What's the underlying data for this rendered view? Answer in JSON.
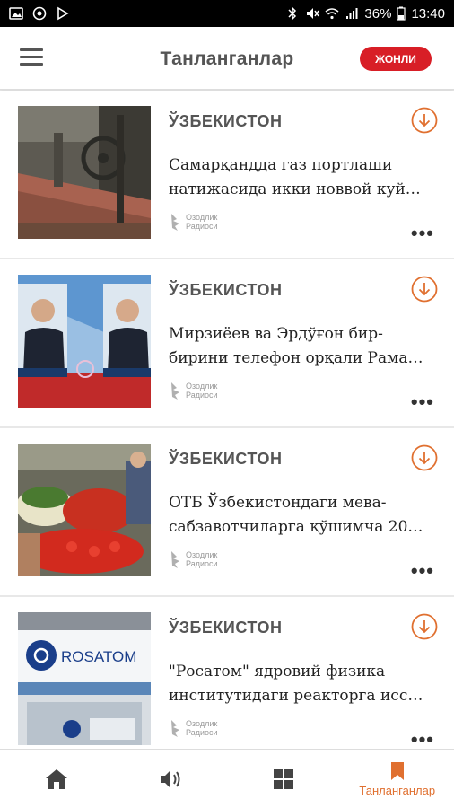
{
  "status_bar": {
    "battery": "36%",
    "time": "13:40"
  },
  "app_bar": {
    "title": "Танланганлар",
    "live_label": "ЖОНЛИ"
  },
  "articles": [
    {
      "category": "ЎЗБЕКИСТОН",
      "headline_line1": "Самарқандда газ портлаши",
      "headline_line2": "натижасида икки новвой куй…",
      "source_line1": "Озодлик",
      "source_line2": "Радиоси"
    },
    {
      "category": "ЎЗБЕКИСТОН",
      "headline_line1": "Мирзиёев ва Эрдўғон бир-",
      "headline_line2": "бирини телефон орқали Рама…",
      "source_line1": "Озодлик",
      "source_line2": "Радиоси"
    },
    {
      "category": "ЎЗБЕКИСТОН",
      "headline_line1": "ОТБ Ўзбекистондаги мева-",
      "headline_line2": "сабзавотчиларга қўшимча 20…",
      "source_line1": "Озодлик",
      "source_line2": "Радиоси"
    },
    {
      "category": "ЎЗБЕКИСТОН",
      "headline_line1": "\"Росатом\" ядровий физика",
      "headline_line2": "институтидаги реакторга исс…",
      "source_line1": "Озодлик",
      "source_line2": "Радиоси"
    }
  ],
  "thumbnails": {
    "rosatom_text": "ROSATOM"
  },
  "bottom_nav": {
    "active_label": "Танланганлар"
  },
  "colors": {
    "accent": "#e07030",
    "live": "#d81e26"
  }
}
